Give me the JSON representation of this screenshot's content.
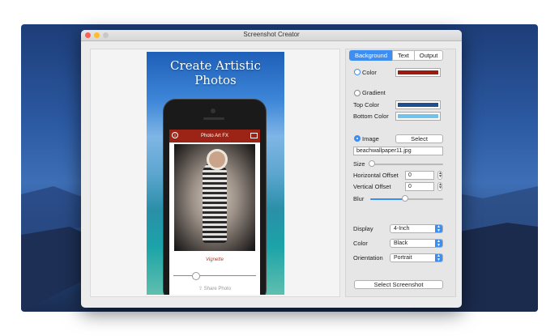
{
  "window": {
    "title": "Screenshot Creator"
  },
  "poster": {
    "title": "Create Artistic\nPhotos",
    "app_title": "Photo Art FX",
    "effect_label": "Vignette",
    "share_label": "Share Photo"
  },
  "panel": {
    "tabs": [
      {
        "label": "Background",
        "active": true
      },
      {
        "label": "Text",
        "active": false
      },
      {
        "label": "Output",
        "active": false
      }
    ],
    "color": {
      "label": "Color",
      "value": "#9c1b0e"
    },
    "gradient": {
      "label": "Gradient",
      "top_label": "Top Color",
      "top_value": "#1f4f8e",
      "bottom_label": "Bottom Color",
      "bottom_value": "#6ec4ef"
    },
    "image": {
      "label": "Image",
      "select_label": "Select",
      "filename": "beachwallpaper11.jpg",
      "size_label": "Size",
      "size_level": 0.02,
      "h_offset_label": "Horizontal Offset",
      "h_offset_value": "0",
      "v_offset_label": "Vertical Offset",
      "v_offset_value": "0",
      "blur_label": "Blur",
      "blur_level": 0.48
    },
    "display": {
      "label": "Display",
      "value": "4-Inch"
    },
    "device_color": {
      "label": "Color",
      "value": "Black"
    },
    "orientation": {
      "label": "Orientation",
      "value": "Portrait"
    },
    "select_screenshot_label": "Select Screenshot"
  },
  "colors": {
    "accent": "#3c8ef3",
    "app_bar": "#9c2416"
  }
}
